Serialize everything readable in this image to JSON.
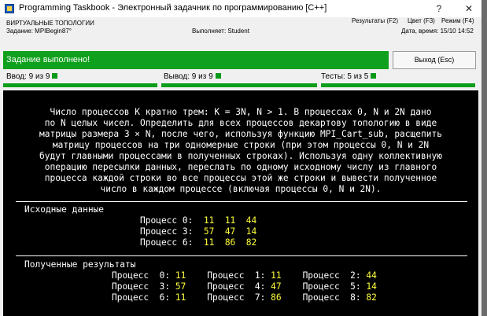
{
  "window": {
    "title": "Programming Taskbook - Электронный задачник по программированию [C++]",
    "help_button": "?",
    "close_button": "✕"
  },
  "header": {
    "group": "ВИРТУАЛЬНЫЕ ТОПОЛОГИИ",
    "task": "Задание: MPIBegin87°",
    "performer": "Выполняет: Student",
    "results": "Результаты (F2)",
    "color": "Цвет (F3)",
    "mode": "Режим (F4)",
    "datetime": "Дата, время: 15/10 14:52"
  },
  "status": {
    "message": "Задание выполнено!",
    "exit_label": "Выход (Esc)",
    "accent": "#0fa01d"
  },
  "counters": {
    "input": "Ввод: 9 из 9",
    "output": "Вывод: 9 из 9",
    "tests": "Тесты: 5 из 5",
    "input_progress": 1.0,
    "output_progress": 1.0,
    "tests_progress": 1.0
  },
  "task": {
    "lines": [
      "Число процессов K кратно трем: K = 3N, N > 1. В процессах 0, N и 2N дано",
      "по N целых чисел. Определить для всех процессов декартову топологию в виде",
      "матрицы размера 3 × N, после чего, используя функцию MPI_Cart_sub, расщепить",
      "матрицу процессов на три одномерные строки (при этом процессы 0, N и 2N",
      "будут главными процессами в полученных строках). Используя одну коллективную",
      "операцию пересылки данных, переслать по одному исходному числу из главного",
      "процесса каждой строки во все процессы этой же строки и вывести полученное",
      "число в каждом процессе (включая процессы 0, N и 2N)."
    ]
  },
  "input_data": {
    "title": "Исходные данные",
    "rows": [
      {
        "label": "Процесс 0:",
        "values": [
          "11",
          "11",
          "44"
        ]
      },
      {
        "label": "Процесс 3:",
        "values": [
          "57",
          "47",
          "14"
        ]
      },
      {
        "label": "Процесс 6:",
        "values": [
          "11",
          "86",
          "82"
        ]
      }
    ]
  },
  "results": {
    "title": "Полученные результаты",
    "rows": [
      [
        {
          "label": "Процесс  0:",
          "value": "11"
        },
        {
          "label": "Процесс  1:",
          "value": "11"
        },
        {
          "label": "Процесс  2:",
          "value": "44"
        }
      ],
      [
        {
          "label": "Процесс  3:",
          "value": "57"
        },
        {
          "label": "Процесс  4:",
          "value": "47"
        },
        {
          "label": "Процесс  5:",
          "value": "14"
        }
      ],
      [
        {
          "label": "Процесс  6:",
          "value": "11"
        },
        {
          "label": "Процесс  7:",
          "value": "86"
        },
        {
          "label": "Процесс  8:",
          "value": "82"
        }
      ]
    ]
  }
}
